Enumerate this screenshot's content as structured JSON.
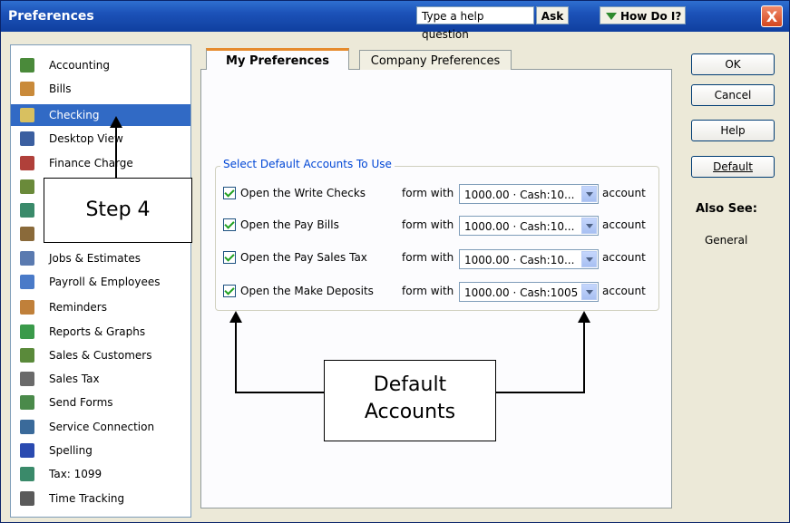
{
  "window": {
    "title": "Preferences",
    "close_label": "X"
  },
  "help": {
    "placeholder": "Type a help question",
    "ask_label": "Ask",
    "how_do_i_label": "How Do I?"
  },
  "sidebar": {
    "items": [
      {
        "label": "Accounting",
        "icon": "accounting-icon",
        "color": "#4a8a3a",
        "selected": false
      },
      {
        "label": "Bills",
        "icon": "bills-icon",
        "color": "#c98a3a",
        "selected": false
      },
      {
        "label": "Checking",
        "icon": "checking-icon",
        "color": "#d8c060",
        "selected": true
      },
      {
        "label": "Desktop View",
        "icon": "desktop-view-icon",
        "color": "#3b5fa0",
        "selected": false
      },
      {
        "label": "Finance Charge",
        "icon": "finance-charge-icon",
        "color": "#b0403a",
        "selected": false
      },
      {
        "label": "",
        "icon": "hidden-item-icon",
        "color": "#6a8a3a",
        "selected": false
      },
      {
        "label": "",
        "icon": "hidden-item-icon",
        "color": "#3a8a6a",
        "selected": false
      },
      {
        "label": "",
        "icon": "hidden-item-icon",
        "color": "#8a6a3a",
        "selected": false
      },
      {
        "label": "Jobs & Estimates",
        "icon": "jobs-estimates-icon",
        "color": "#5a7ab0",
        "selected": false
      },
      {
        "label": "Payroll & Employees",
        "icon": "payroll-icon",
        "color": "#4a7ac8",
        "selected": false
      },
      {
        "label": "Reminders",
        "icon": "reminders-icon",
        "color": "#c0803a",
        "selected": false
      },
      {
        "label": "Reports & Graphs",
        "icon": "reports-graphs-icon",
        "color": "#3a9a4a",
        "selected": false
      },
      {
        "label": "Sales & Customers",
        "icon": "sales-customers-icon",
        "color": "#5a8a3a",
        "selected": false
      },
      {
        "label": "Sales Tax",
        "icon": "sales-tax-icon",
        "color": "#6a6a6a",
        "selected": false
      },
      {
        "label": "Send Forms",
        "icon": "send-forms-icon",
        "color": "#4a8a4a",
        "selected": false
      },
      {
        "label": "Service Connection",
        "icon": "service-connection-icon",
        "color": "#3a6a9a",
        "selected": false
      },
      {
        "label": "Spelling",
        "icon": "spelling-icon",
        "color": "#2a4ab0",
        "selected": false
      },
      {
        "label": "Tax: 1099",
        "icon": "tax-1099-icon",
        "color": "#3a8a6a",
        "selected": false
      },
      {
        "label": "Time Tracking",
        "icon": "time-tracking-icon",
        "color": "#5a5a5a",
        "selected": false
      }
    ]
  },
  "tabs": {
    "my_preferences": "My Preferences",
    "company_preferences": "Company Preferences"
  },
  "defaults": {
    "legend": "Select Default Accounts To Use",
    "form_with": "form with",
    "account_suffix": "account",
    "rows": [
      {
        "label": "Open the Write Checks",
        "checked": true,
        "value": "1000.00 · Cash:10..."
      },
      {
        "label": "Open the Pay Bills",
        "checked": true,
        "value": "1000.00 · Cash:10..."
      },
      {
        "label": "Open the Pay Sales Tax",
        "checked": true,
        "value": "1000.00 · Cash:10..."
      },
      {
        "label": "Open the Make Deposits",
        "checked": true,
        "value": "1000.00 · Cash:1005"
      }
    ]
  },
  "buttons": {
    "ok": "OK",
    "cancel": "Cancel",
    "help": "Help",
    "default": "Default"
  },
  "also_see": {
    "heading": "Also See:",
    "general": "General"
  },
  "callouts": {
    "step": "Step 4",
    "default_line1": "Default",
    "default_line2": "Accounts"
  }
}
